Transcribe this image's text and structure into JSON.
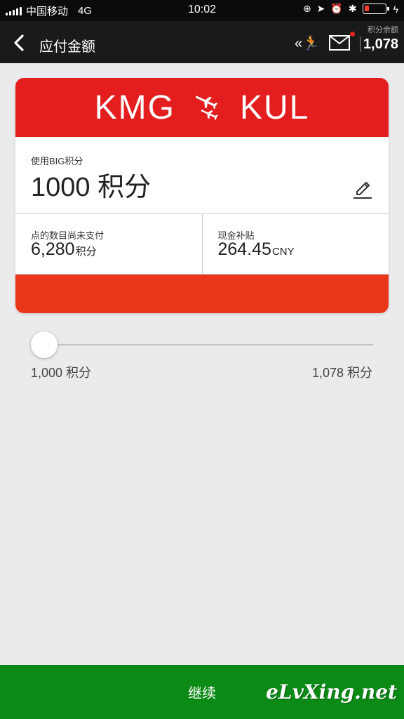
{
  "status_bar": {
    "carrier": "中国移动",
    "network": "4G",
    "time": "10:02"
  },
  "nav": {
    "title": "应付金额",
    "balance_label": "积分余额",
    "balance_value": "1,078"
  },
  "route": {
    "origin": "KMG",
    "destination": "KUL"
  },
  "points": {
    "label": "使用BIG积分",
    "value": "1000 积分"
  },
  "unpaid": {
    "label": "点的数目尚未支付",
    "value": "6,280",
    "unit": "积分"
  },
  "cash": {
    "label": "现金补贴",
    "value": "264.45",
    "unit": "CNY"
  },
  "slider": {
    "min_label": "1,000 积分",
    "max_label": "1,078 积分",
    "min": 1000,
    "max": 1078,
    "value": 1000
  },
  "continue_label": "继续",
  "watermark": "eLvXing.net",
  "colors": {
    "brand_red": "#e41e1e",
    "footer_red": "#e8361a",
    "continue_green": "#0c8a16"
  },
  "icons": [
    "back-icon",
    "runner-icon",
    "mail-icon",
    "plane-icon",
    "edit-icon",
    "location-icon",
    "alarm-icon",
    "bluetooth-icon",
    "battery-icon"
  ]
}
